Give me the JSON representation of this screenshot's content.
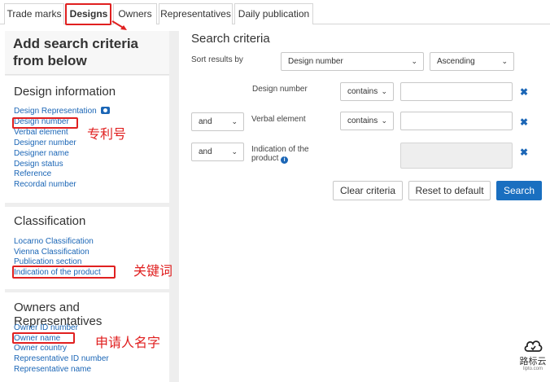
{
  "tabs": [
    {
      "label": "Trade marks"
    },
    {
      "label": "Designs"
    },
    {
      "label": "Owners"
    },
    {
      "label": "Representatives"
    },
    {
      "label": "Daily publication"
    }
  ],
  "left": {
    "heading": "Add search criteria from below",
    "design_info": {
      "title": "Design information",
      "links": [
        "Design Representation",
        "Design number",
        "Verbal element",
        "Designer number",
        "Designer name",
        "Design status",
        "Reference",
        "Recordal number"
      ]
    },
    "classification": {
      "title": "Classification",
      "links": [
        "Locarno Classification",
        "Vienna Classification",
        "Publication section",
        "Indication of the product"
      ]
    },
    "owners_reps": {
      "title": "Owners and Representatives",
      "links": [
        "Owner ID number",
        "Owner name",
        "Owner country",
        "Representative ID number",
        "Representative name"
      ]
    }
  },
  "annotations": {
    "patent_number": "专利号",
    "keyword": "关键词",
    "applicant_name": "申请人名字"
  },
  "right": {
    "title": "Search criteria",
    "sort_label": "Sort results by",
    "sort_field": "Design number",
    "sort_order": "Ascending",
    "rows": [
      {
        "connector": "",
        "label": "Design number",
        "operator": "contains",
        "value": "",
        "disabled": false
      },
      {
        "connector": "and",
        "label": "Verbal element",
        "operator": "contains",
        "value": "",
        "disabled": false
      },
      {
        "connector": "and",
        "label": "Indication of the product",
        "operator": "",
        "value": "",
        "disabled": true
      }
    ],
    "buttons": {
      "clear": "Clear criteria",
      "reset": "Reset to default",
      "search": "Search"
    }
  },
  "watermark": {
    "text": "路标云",
    "sub": "lipto.com"
  },
  "colors": {
    "link": "#1b66b6",
    "primary": "#1a6fc0",
    "annotation": "#e02020"
  }
}
